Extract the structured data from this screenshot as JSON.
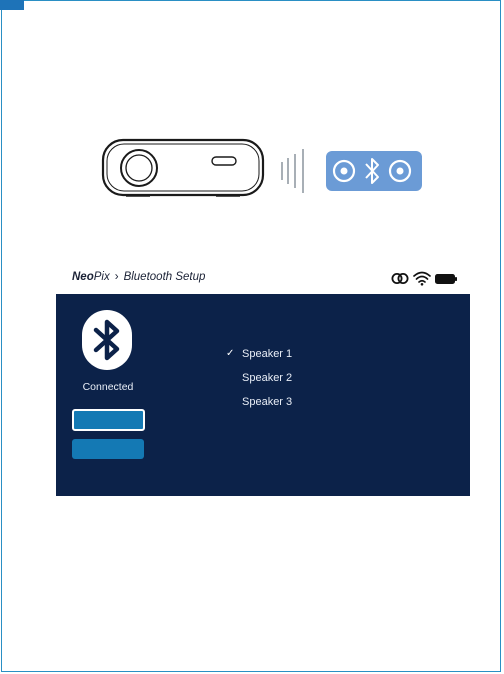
{
  "breadcrumb": {
    "brand_bold": "Neo",
    "brand_light": "Pix",
    "separator": "›",
    "page": "Bluetooth Setup"
  },
  "status_icons": [
    "link-icon",
    "wifi-icon",
    "battery-icon"
  ],
  "bluetooth_panel": {
    "status": "Connected",
    "icon": "bluetooth-icon"
  },
  "devices": [
    {
      "label": "Speaker 1",
      "selected": true,
      "check": "✓"
    },
    {
      "label": "Speaker 2",
      "selected": false,
      "check": ""
    },
    {
      "label": "Speaker 3",
      "selected": false,
      "check": ""
    }
  ],
  "colors": {
    "panel_bg": "#0c2249",
    "button": "#1479b4",
    "speaker_illustration": "#6b9bd6",
    "frame_border": "#2a8fc4"
  }
}
